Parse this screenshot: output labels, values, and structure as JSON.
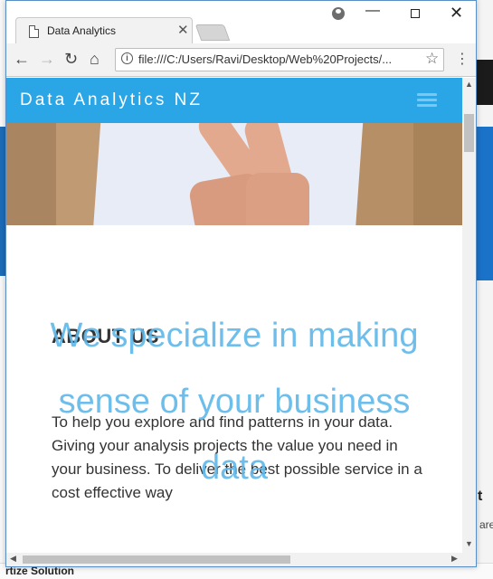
{
  "browser": {
    "tab_title": "Data Analytics",
    "tab_close": "✕",
    "url": "file:///C:/Users/Ravi/Desktop/Web%20Projects/...",
    "nav": {
      "back": "←",
      "forward": "→",
      "reload": "↻",
      "home": "⌂",
      "star": "☆",
      "menu": "⋮"
    },
    "window_controls": {
      "minimize": "—",
      "close": "✕"
    },
    "icons": [
      "document-icon",
      "profile-icon",
      "info-icon",
      "star-icon",
      "menu-icon"
    ]
  },
  "site": {
    "brand": "Data Analytics NZ",
    "hero_overlay": "We specialize in making sense of your business data",
    "about": {
      "title": "ABOUT US",
      "text": "To help you explore and find patterns in your data. Giving your analysis projects the value you need in your business. To deliver the best possible service in a cost effective way"
    }
  },
  "background_window": {
    "right_heading": "t",
    "right_text": "are",
    "bottom_text": "rtize Solution"
  },
  "colors": {
    "nav_blue": "#2aa5e5",
    "overlay_blue": "#5fb8ea",
    "window_border": "#5a8fc6"
  }
}
